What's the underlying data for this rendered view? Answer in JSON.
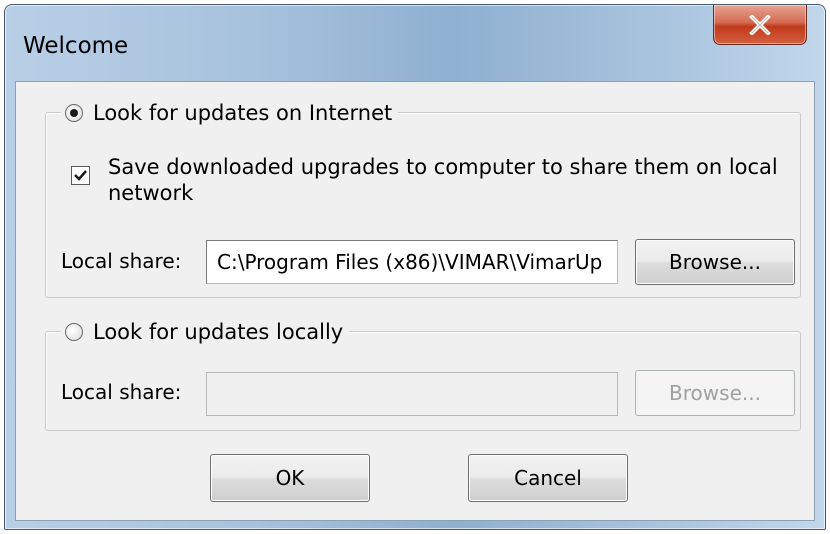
{
  "window": {
    "title": "Welcome",
    "close_glyph": "X",
    "colors": {
      "client_background": "#f0f0f0",
      "close_button": "#c0391b"
    }
  },
  "internet_group": {
    "radio_label": "Look for updates on Internet",
    "selected": true,
    "save_checkbox": {
      "label_line1": "Save downloaded upgrades to computer to share them on local",
      "label_line2": "network",
      "checked": true
    },
    "local_share_label": "Local share:",
    "local_share_value": "C:\\Program Files (x86)\\VIMAR\\VimarUp",
    "browse_label": "Browse..."
  },
  "local_group": {
    "radio_label": "Look for updates locally",
    "selected": false,
    "local_share_label": "Local share:",
    "local_share_value": "",
    "browse_label": "Browse..."
  },
  "footer": {
    "ok_label": "OK",
    "cancel_label": "Cancel"
  }
}
